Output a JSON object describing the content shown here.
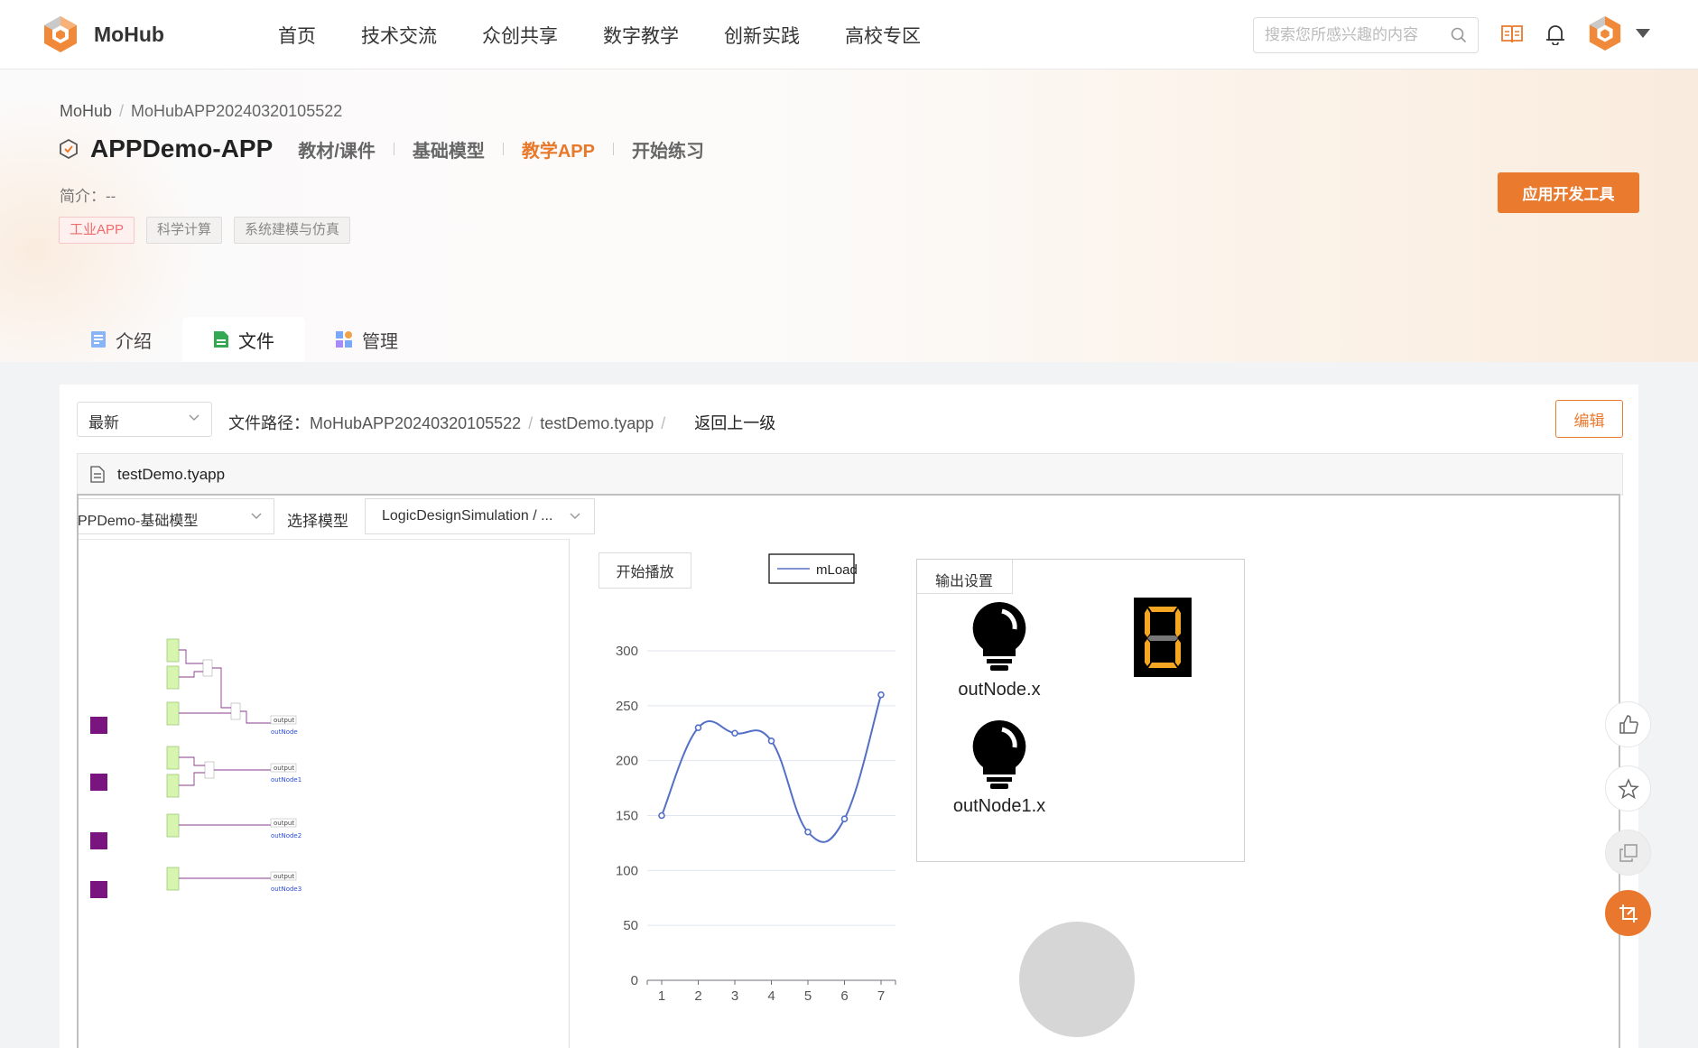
{
  "brand": {
    "name": "MoHub"
  },
  "nav": {
    "items": [
      "首页",
      "技术交流",
      "众创共享",
      "数字教学",
      "创新实践",
      "高校专区"
    ],
    "search_placeholder": "搜索您所感兴趣的内容"
  },
  "breadcrumb": {
    "root": "MoHub",
    "current": "MoHubAPP20240320105522"
  },
  "project": {
    "title": "APPDemo-APP",
    "sub_tabs": [
      "教材/课件",
      "基础模型",
      "教学APP",
      "开始练习"
    ],
    "active_sub_tab": "教学APP",
    "intro": "简介：--",
    "tags": [
      "工业APP",
      "科学计算",
      "系统建模与仿真"
    ],
    "dev_tool_button": "应用开发工具"
  },
  "main_tabs": [
    "介绍",
    "文件",
    "管理"
  ],
  "active_main_tab": "文件",
  "file_browser": {
    "version": "最新",
    "path_label": "文件路径：",
    "path_parts": [
      "MoHubAPP20240320105522",
      "testDemo.tyapp"
    ],
    "back_label": "返回上一级",
    "edit_button": "编辑",
    "file_name": "testDemo.tyapp"
  },
  "app": {
    "model_value": "PPDemo-基础模型",
    "select_model_label": "选择模型",
    "simulation_value": "LogicDesignSimulation / ...",
    "play_button": "开始播放",
    "output_title": "输出设置",
    "bulbs": [
      "outNode.x",
      "outNode1.x"
    ],
    "diagram": {
      "output_label": "output",
      "nodes": [
        "outNode",
        "outNode1",
        "outNode2",
        "outNode3"
      ]
    }
  },
  "chart_data": {
    "type": "line",
    "x": [
      1,
      2,
      3,
      4,
      5,
      6,
      7
    ],
    "series": [
      {
        "name": "mLoad",
        "values": [
          150,
          230,
          225,
          218,
          135,
          147,
          260
        ]
      }
    ],
    "ylim": [
      0,
      300
    ],
    "yticks": [
      0,
      50,
      100,
      150,
      200,
      250,
      300
    ],
    "legend": "top-right",
    "grid": true,
    "color": "#5470c6"
  },
  "colors": {
    "accent": "#e97a2e",
    "tag_red": "#f06b6b"
  }
}
